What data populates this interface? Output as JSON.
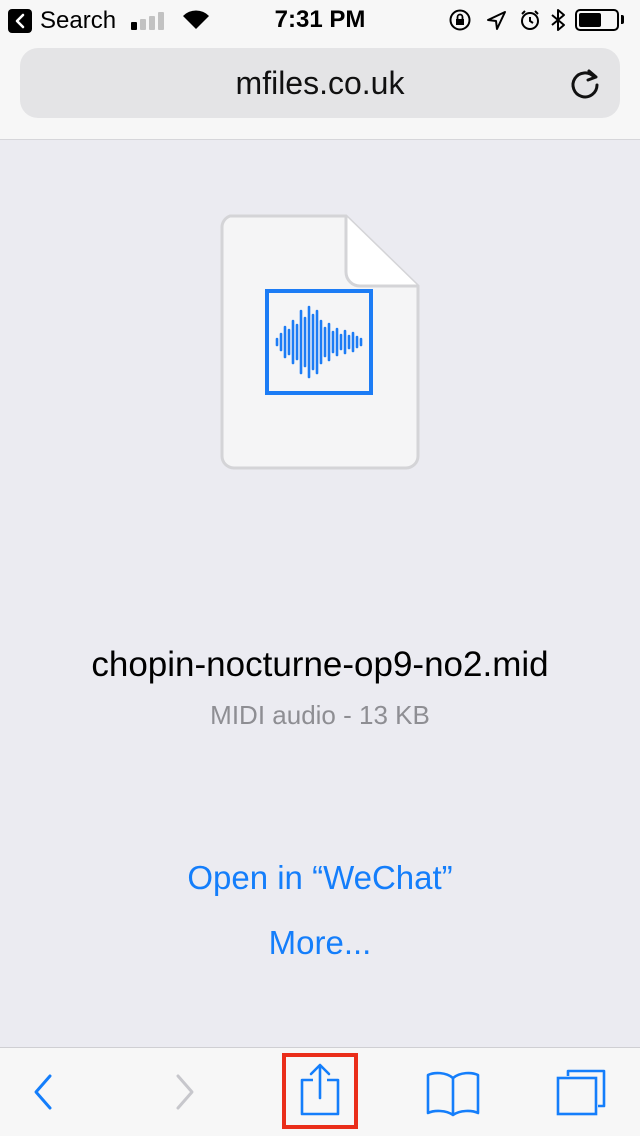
{
  "status_bar": {
    "back_app_label": "Search",
    "time": "7:31 PM",
    "signal_bars_filled": 1,
    "signal_bars_total": 4,
    "battery_level": 0.6,
    "icons": [
      "lock-rotation-icon",
      "location-arrow-icon",
      "alarm-icon",
      "bluetooth-icon",
      "battery-icon"
    ]
  },
  "address_bar": {
    "url": "mfiles.co.uk",
    "reload_icon": "reload-icon"
  },
  "file": {
    "icon": "audio-waveform-document-icon",
    "name": "chopin-nocturne-op9-no2.mid",
    "meta": "MIDI audio - 13 KB"
  },
  "actions": {
    "open_in": "Open in “WeChat”",
    "more": "More..."
  },
  "toolbar": {
    "items": [
      "back-icon",
      "forward-icon",
      "share-icon",
      "bookmarks-icon",
      "tabs-icon"
    ],
    "highlighted": "share-icon"
  },
  "colors": {
    "accent": "#147efb",
    "highlight": "#ea2e1a",
    "disabled": "#c7c7cc",
    "secondary_text": "#8e8e93"
  }
}
